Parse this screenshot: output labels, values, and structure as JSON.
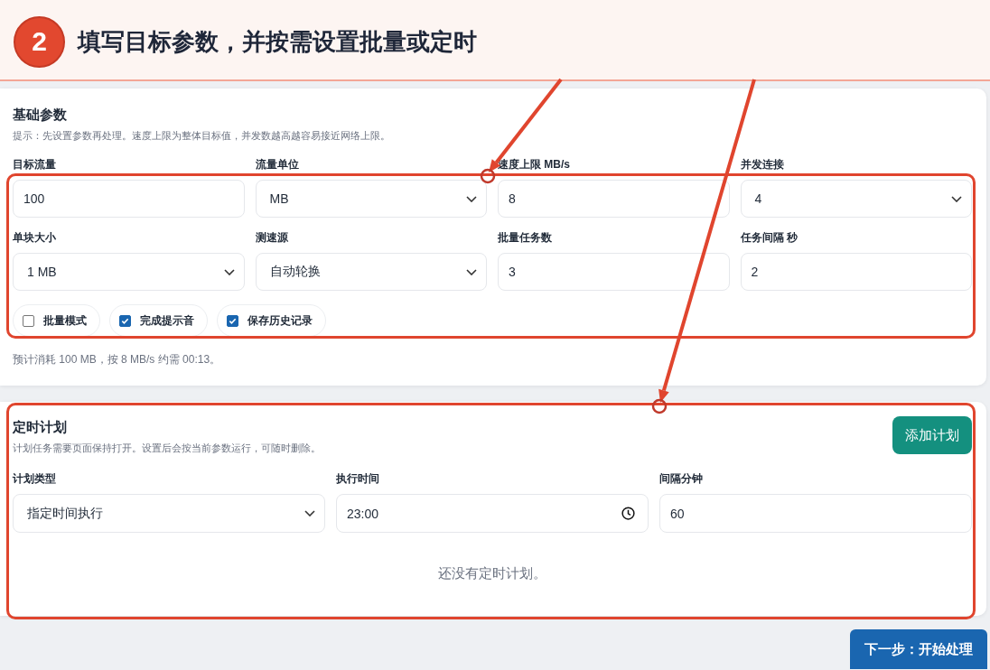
{
  "step": {
    "number": "2",
    "title": "填写目标参数，并按需设置批量或定时"
  },
  "basic": {
    "title": "基础参数",
    "hint": "提示：先设置参数再处理。速度上限为整体目标值，并发数越高越容易接近网络上限。",
    "form": {
      "highlighted": true,
      "fields": [
        {
          "label": "目标流量",
          "kind": "input",
          "value": "100"
        },
        {
          "label": "流量单位",
          "kind": "select",
          "value": "MB"
        },
        {
          "label": "速度上限 MB/s",
          "kind": "input",
          "value": "8"
        },
        {
          "label": "并发连接",
          "kind": "select",
          "value": "4"
        },
        {
          "label": "单块大小",
          "kind": "select",
          "value": "1 MB"
        },
        {
          "label": "测速源",
          "kind": "select",
          "value": "自动轮换"
        },
        {
          "label": "批量任务数",
          "kind": "input",
          "value": "3"
        },
        {
          "label": "任务间隔 秒",
          "kind": "input",
          "value": "2"
        }
      ],
      "options": [
        {
          "label": "批量模式",
          "checked": false
        },
        {
          "label": "完成提示音",
          "checked": true
        },
        {
          "label": "保存历史记录",
          "checked": true
        }
      ]
    },
    "summary": "预计消耗 100 MB，按 8 MB/s 约需 00:13。"
  },
  "schedule": {
    "highlighted": true,
    "title": "定时计划",
    "hint": "计划任务需要页面保持打开。设置后会按当前参数运行，可随时删除。",
    "add_button": "添加计划",
    "fields": [
      {
        "label": "计划类型",
        "kind": "select",
        "value": "指定时间执行"
      },
      {
        "label": "执行时间",
        "kind": "time",
        "value": "23:00"
      },
      {
        "label": "间隔分钟",
        "kind": "input",
        "value": "60"
      }
    ],
    "empty_message": "还没有定时计划。"
  },
  "next_button": "下一步：开始处理"
}
